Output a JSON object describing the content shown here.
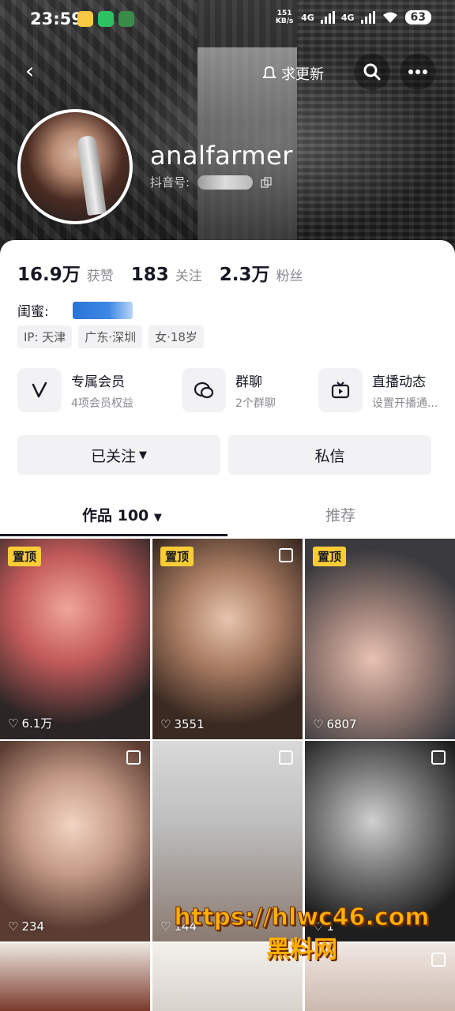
{
  "status_bar": {
    "time": "23:59",
    "net_speed": "151 KB/s",
    "net1": "4G",
    "net2": "4G",
    "battery": "63"
  },
  "top_nav": {
    "update_label": "求更新"
  },
  "profile": {
    "nickname": "analfarmer",
    "douyin_id_label": "抖音号:"
  },
  "stats": [
    {
      "value": "16.9万",
      "label": "获赞"
    },
    {
      "value": "183",
      "label": "关注"
    },
    {
      "value": "2.3万",
      "label": "粉丝"
    }
  ],
  "bestie_label": "闺蜜:",
  "tags": [
    "IP: 天津",
    "广东·深圳",
    "女·18岁"
  ],
  "features": [
    {
      "title": "专属会员",
      "subtitle": "4项会员权益",
      "icon": "v-vip-icon"
    },
    {
      "title": "群聊",
      "subtitle": "2个群聊",
      "icon": "chat-bubble-icon"
    },
    {
      "title": "直播动态",
      "subtitle": "设置开播通...",
      "icon": "tv-icon"
    }
  ],
  "actions": {
    "followed": "已关注",
    "message": "私信"
  },
  "tabs": {
    "works": "作品 100",
    "recommend": "推荐"
  },
  "videos": [
    {
      "pinned": "置顶",
      "likes": "6.1万"
    },
    {
      "pinned": "置顶",
      "likes": "3551"
    },
    {
      "pinned": "置顶",
      "likes": "6807"
    },
    {
      "pinned": "",
      "likes": "234"
    },
    {
      "pinned": "",
      "likes": "144"
    },
    {
      "pinned": "",
      "likes": "1"
    }
  ],
  "watermark": {
    "url": "https://hlwc46.com",
    "name": "黑料网"
  },
  "colors": {
    "pin_badge": "#facd38",
    "text_primary": "#161823",
    "text_secondary": "#8a8b91",
    "chip_bg": "#f2f2f4"
  }
}
